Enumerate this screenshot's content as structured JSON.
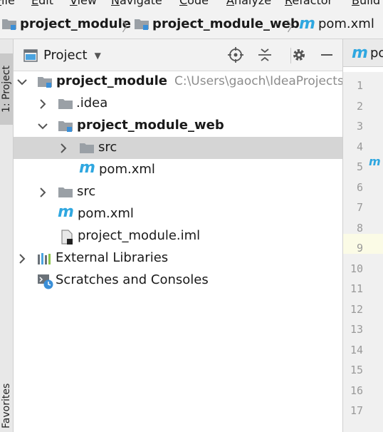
{
  "menubar": {
    "items": [
      "File",
      "Edit",
      "View",
      "Navigate",
      "Code",
      "Analyze",
      "Refactor",
      "Build"
    ]
  },
  "breadcrumb": {
    "items": [
      "project_module",
      "project_module_web",
      "pom.xml"
    ]
  },
  "toolwindow": {
    "left_tabs": [
      "1: Project",
      "Favorites"
    ]
  },
  "project_panel": {
    "title": "Project",
    "buttons": [
      "locate-icon",
      "collapse-all-icon",
      "gear-icon",
      "minimize-icon"
    ]
  },
  "tree": {
    "root": {
      "name": "project_module",
      "path": "C:\\Users\\gaoch\\IdeaProjects\\p"
    },
    "idea": ".idea",
    "web_module": "project_module_web",
    "web_src": "src",
    "web_pom": "pom.xml",
    "src": "src",
    "pom": "pom.xml",
    "iml": "project_module.iml",
    "external_libraries": "External Libraries",
    "scratches": "Scratches and Consoles"
  },
  "editor": {
    "tab_label": "pom.xml",
    "line_numbers": [
      "1",
      "2",
      "3",
      "4",
      "5",
      "6",
      "7",
      "8",
      "9",
      "10",
      "11",
      "12",
      "13",
      "14",
      "15",
      "16",
      "17"
    ]
  },
  "colors": {
    "maven_blue": "#2fa7e0",
    "folder_gray": "#9aa0a6",
    "module_blue": "#3a8fd8",
    "selection": "#d5d5d5",
    "editor_tab_blue": "#2fa7e0"
  }
}
